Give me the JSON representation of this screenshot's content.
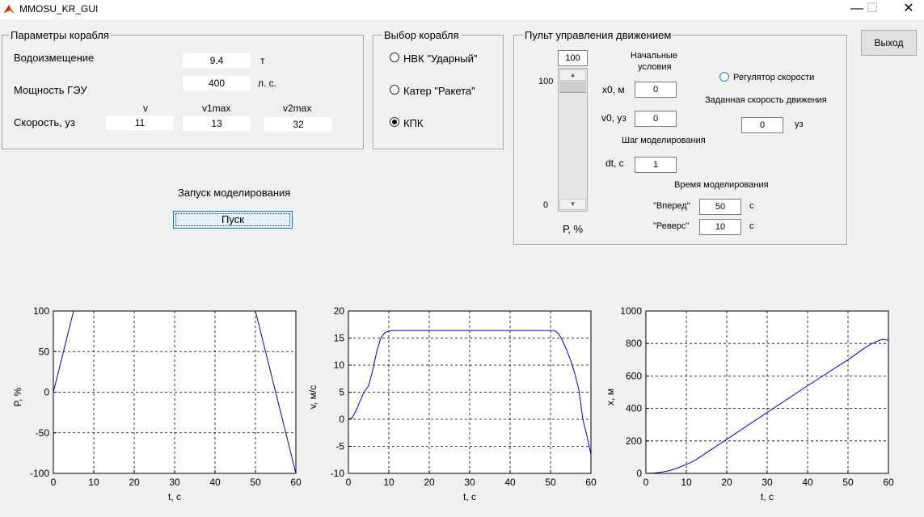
{
  "window": {
    "title": "MMOSU_KR_GUI",
    "minimize": "—",
    "maximize": "☐",
    "close": "✕"
  },
  "ship_params": {
    "title": "Параметры корабля",
    "displacement_label": "Водоизмещение",
    "displacement_value": "9.4",
    "displacement_unit": "т",
    "power_label": "Мощность ГЭУ",
    "power_value": "400",
    "power_unit": "л. с.",
    "speed_label": "Скорость, уз",
    "v_header": "v",
    "v1max_header": "v1max",
    "v2max_header": "v2max",
    "v_value": "11",
    "v1max_value": "13",
    "v2max_value": "32"
  },
  "ship_select": {
    "title": "Выбор корабля",
    "options": [
      {
        "label": "НВК \"Ударный\"",
        "selected": false
      },
      {
        "label": "Катер \"Ракета\"",
        "selected": false
      },
      {
        "label": "КПК",
        "selected": true
      }
    ]
  },
  "simulation": {
    "label": "Запуск моделирования",
    "start_button": "Пуск"
  },
  "exit_button": "Выход",
  "control_panel": {
    "title": "Пульт управления движением",
    "slider_value": "100",
    "slider_max_label": "100",
    "slider_min_label": "0",
    "slider_axis_label": "Р, %",
    "initial_conditions_line1": "Начальные",
    "initial_conditions_line2": "условия",
    "x0_label": "x0, м",
    "x0_value": "0",
    "v0_label": "v0, уз",
    "v0_value": "0",
    "step_label": "Шаг моделирования",
    "dt_label": "dt, с",
    "dt_value": "1",
    "sim_time_label": "Время моделирования",
    "forward_label": "\"Вперед\"",
    "forward_value": "50",
    "forward_unit": "с",
    "reverse_label": "\"Реверс\"",
    "reverse_value": "10",
    "reverse_unit": "с",
    "speed_regulator_label": "Регулятор скорости",
    "speed_regulator_selected": false,
    "target_speed_label": "Заданная скорость движения",
    "target_speed_value": "0",
    "target_speed_unit": "уз"
  },
  "chart_data": [
    {
      "type": "line",
      "xlabel": "t, с",
      "ylabel": "P, %",
      "xlim": [
        0,
        60
      ],
      "ylim": [
        -100,
        100
      ],
      "xticks": [
        0,
        10,
        20,
        30,
        40,
        50,
        60
      ],
      "yticks": [
        -100,
        -50,
        0,
        50,
        100
      ],
      "grid": true,
      "series": [
        {
          "color": "#0000cc",
          "x": [
            0,
            5,
            50,
            60
          ],
          "y": [
            0,
            100,
            100,
            -100
          ]
        }
      ]
    },
    {
      "type": "line",
      "xlabel": "t, с",
      "ylabel": "v, м/с",
      "xlim": [
        0,
        60
      ],
      "ylim": [
        -10,
        20
      ],
      "xticks": [
        0,
        10,
        20,
        30,
        40,
        50,
        60
      ],
      "yticks": [
        -10,
        -5,
        0,
        5,
        10,
        15,
        20
      ],
      "grid": true,
      "series": [
        {
          "color": "#0000cc",
          "x": [
            0,
            1,
            2,
            3,
            4,
            5,
            6,
            7,
            8,
            9,
            10,
            11,
            12,
            50,
            51,
            52,
            53,
            54,
            55,
            56,
            57,
            58,
            59,
            60
          ],
          "y": [
            0,
            0.3,
            1.8,
            3.6,
            5.2,
            6.2,
            9,
            12.5,
            15,
            16,
            16.3,
            16.4,
            16.4,
            16.4,
            16.4,
            15.8,
            14.5,
            12.8,
            10.8,
            8.5,
            5.5,
            0,
            -3,
            -6.5
          ]
        }
      ]
    },
    {
      "type": "line",
      "xlabel": "t, с",
      "ylabel": "x, м",
      "xlim": [
        0,
        60
      ],
      "ylim": [
        0,
        1000
      ],
      "xticks": [
        0,
        10,
        20,
        30,
        40,
        50,
        60
      ],
      "yticks": [
        0,
        200,
        400,
        600,
        800,
        1000
      ],
      "grid": true,
      "series": [
        {
          "color": "#0000cc",
          "x": [
            0,
            2,
            4,
            6,
            8,
            10,
            12,
            20,
            30,
            40,
            50,
            52,
            54,
            56,
            58,
            59,
            60
          ],
          "y": [
            0,
            2,
            8,
            18,
            35,
            55,
            78,
            210,
            375,
            540,
            700,
            735,
            770,
            800,
            822,
            825,
            820
          ]
        }
      ]
    }
  ]
}
